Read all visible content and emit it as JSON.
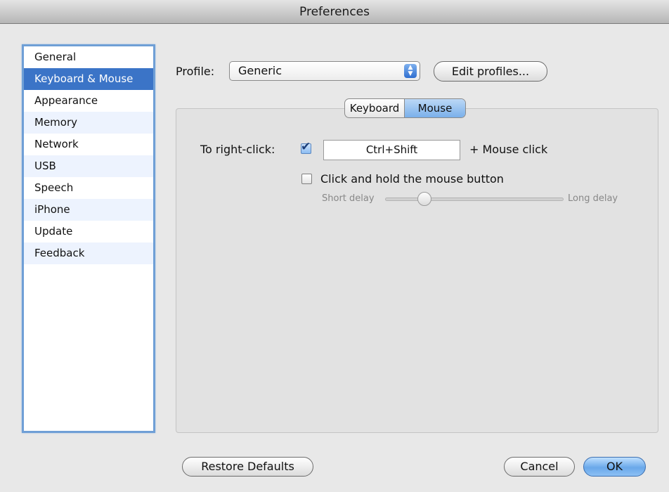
{
  "window": {
    "title": "Preferences"
  },
  "sidebar": {
    "items": [
      {
        "label": "General"
      },
      {
        "label": "Keyboard & Mouse",
        "selected": true
      },
      {
        "label": "Appearance"
      },
      {
        "label": "Memory"
      },
      {
        "label": "Network"
      },
      {
        "label": "USB"
      },
      {
        "label": "Speech"
      },
      {
        "label": "iPhone"
      },
      {
        "label": "Update"
      },
      {
        "label": "Feedback"
      }
    ]
  },
  "profile": {
    "label": "Profile:",
    "selected": "Generic",
    "edit_button": "Edit profiles..."
  },
  "tabs": [
    {
      "label": "Keyboard"
    },
    {
      "label": "Mouse",
      "selected": true
    }
  ],
  "mouse": {
    "right_click_label": "To right-click:",
    "right_click_checked": true,
    "modifier_keys": "Ctrl+Shift",
    "suffix_label": "+ Mouse click",
    "hold_label": "Click and hold the mouse button",
    "hold_checked": false,
    "slider": {
      "min_label": "Short delay",
      "max_label": "Long delay",
      "value": 0.22
    }
  },
  "footer": {
    "restore_label": "Restore Defaults",
    "cancel_label": "Cancel",
    "ok_label": "OK"
  },
  "colors": {
    "selection": "#3b74c7",
    "accent": "#6f9fd6",
    "window_bg": "#e8e8e8"
  }
}
